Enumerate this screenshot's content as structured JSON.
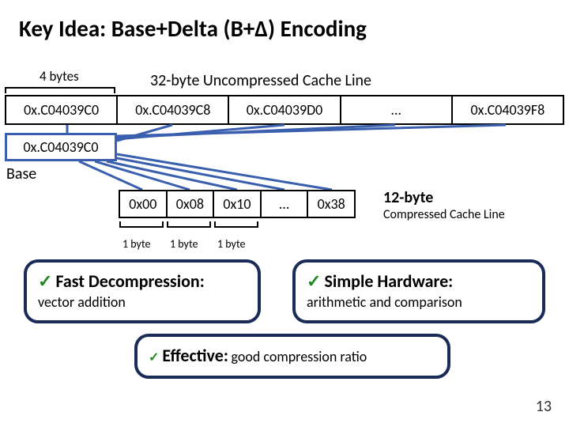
{
  "title": "Key Idea: Base+Delta (B+Δ) Encoding",
  "labels": {
    "four_bytes": "4 bytes",
    "uncompressed_line": "32-byte Uncompressed Cache Line",
    "base": "Base",
    "one_byte": "1 byte",
    "twelve_byte": "12-byte",
    "compressed_line": "Compressed Cache Line"
  },
  "uncompressed": {
    "cells": [
      "0x.C04039C0",
      "0x.C04039C8",
      "0x.C04039D0",
      "…",
      "0x.C04039F8"
    ]
  },
  "base_value": "0x.C04039C0",
  "deltas": {
    "cells": [
      "0x00",
      "0x08",
      "0x10",
      "…",
      "0x38"
    ]
  },
  "bullets": {
    "fast": {
      "head": "Fast Decompression:",
      "sub": "vector addition"
    },
    "simple": {
      "head": "Simple Hardware:",
      "sub": "arithmetic and comparison"
    },
    "effective": {
      "head": "Effective:",
      "sub": "good compression ratio"
    }
  },
  "page_number": "13",
  "colors": {
    "accent_blue": "#3a5fae",
    "check_green": "#1e8a1e",
    "box_border": "#1a2b57"
  }
}
